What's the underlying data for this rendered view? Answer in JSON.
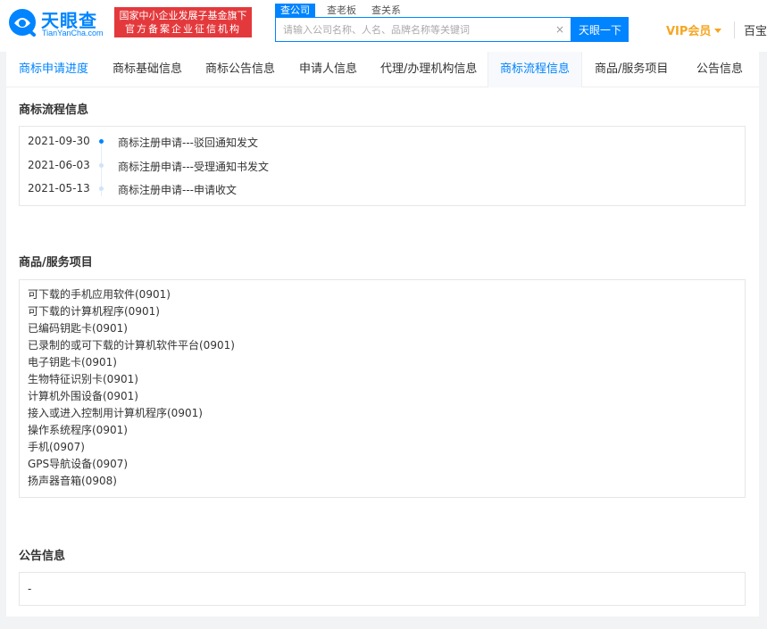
{
  "header": {
    "logo_cn": "天眼查",
    "logo_en": "TianYanCha.com",
    "slogan_line1": "国家中小企业发展子基金旗下",
    "slogan_line2": "官方备案企业征信机构",
    "search_tabs": [
      "查公司",
      "查老板",
      "查关系"
    ],
    "search_placeholder": "请输入公司名称、人名、品牌名称等关键词",
    "clear_symbol": "×",
    "search_button": "天眼一下",
    "vip_label": "VIP会员",
    "baike_label": "百宝箱"
  },
  "tabs": [
    {
      "label": "商标申请进度"
    },
    {
      "label": "商标基础信息"
    },
    {
      "label": "商标公告信息"
    },
    {
      "label": "申请人信息"
    },
    {
      "label": "代理/办理机构信息"
    },
    {
      "label": "商标流程信息"
    },
    {
      "label": "商品/服务项目"
    },
    {
      "label": "公告信息"
    }
  ],
  "flow": {
    "title": "商标流程信息",
    "items": [
      {
        "date": "2021-09-30",
        "text": "商标注册申请---驳回通知发文"
      },
      {
        "date": "2021-06-03",
        "text": "商标注册申请---受理通知书发文"
      },
      {
        "date": "2021-05-13",
        "text": "商标注册申请---申请收文"
      }
    ]
  },
  "goods": {
    "title": "商品/服务项目",
    "items": [
      "可下载的手机应用软件(0901)",
      "可下载的计算机程序(0901)",
      "已编码钥匙卡(0901)",
      "已录制的或可下载的计算机软件平台(0901)",
      "电子钥匙卡(0901)",
      "生物特征识别卡(0901)",
      "计算机外围设备(0901)",
      "接入或进入控制用计算机程序(0901)",
      "操作系统程序(0901)",
      "手机(0907)",
      "GPS导航设备(0907)",
      "扬声器音箱(0908)"
    ]
  },
  "notice": {
    "title": "公告信息",
    "value": "-"
  },
  "colors": {
    "accent": "#0084ff",
    "slogan_bg": "#e4393c",
    "vip": "#f5a623"
  }
}
